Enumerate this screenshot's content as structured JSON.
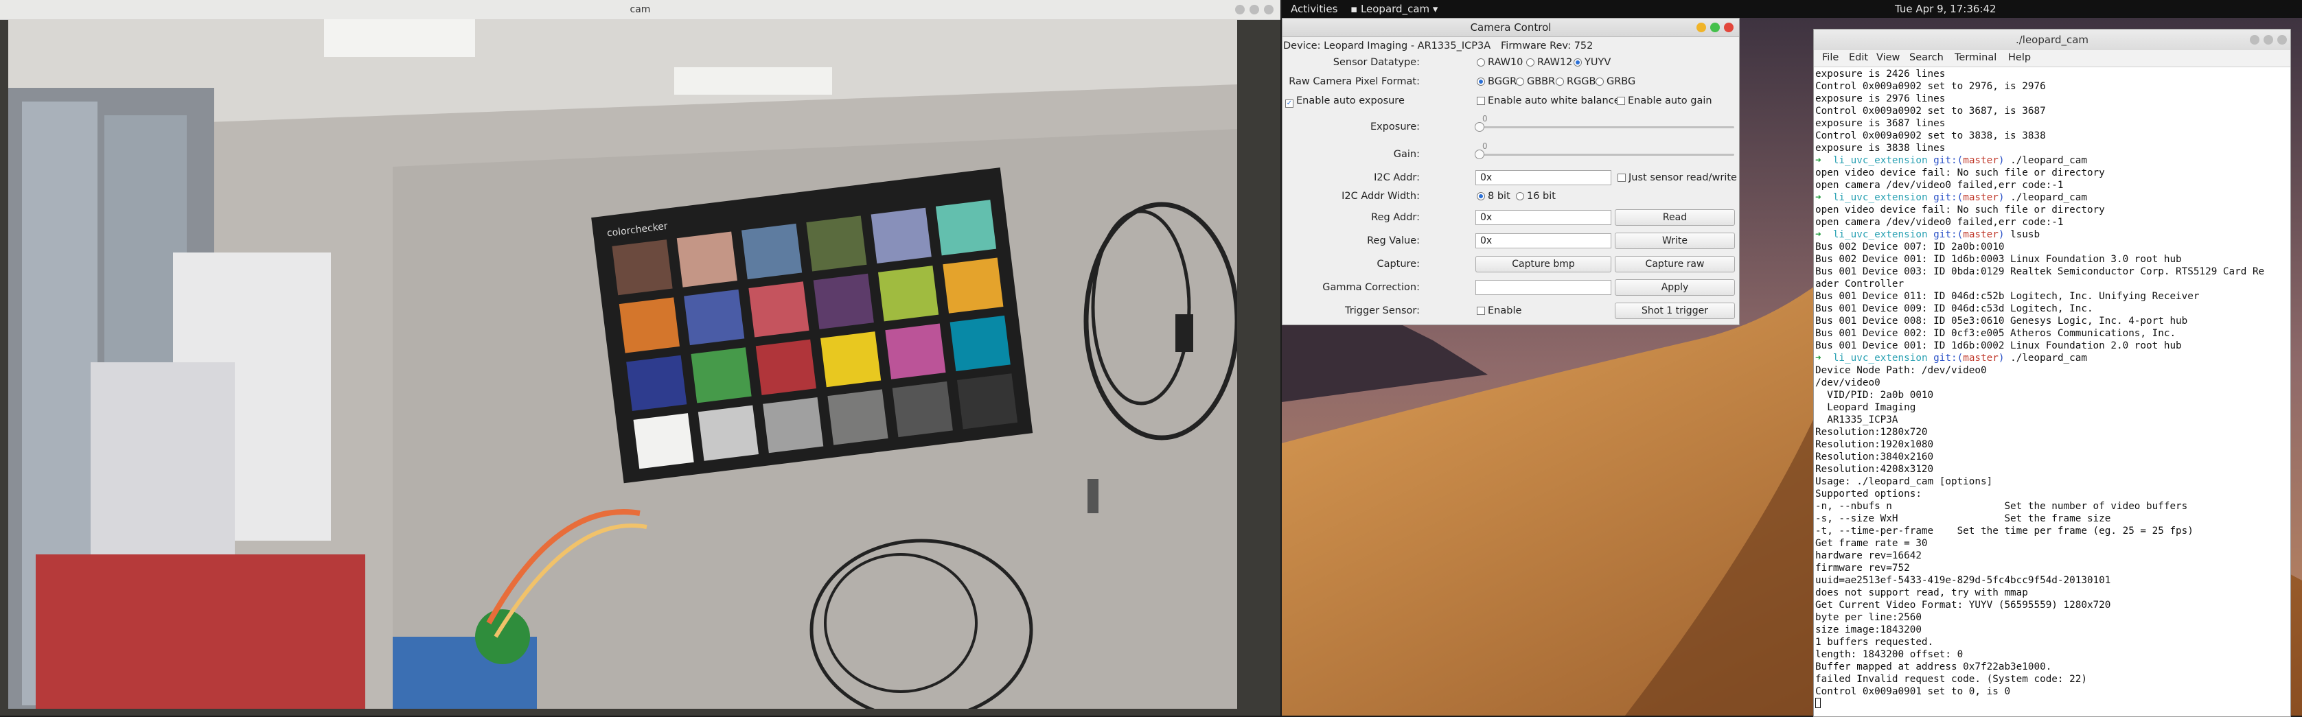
{
  "topbar": {
    "activities": "Activities",
    "app_menu": "Leopard_cam",
    "clock": "Tue Apr  9, 17:36:42"
  },
  "cam_window": {
    "title": "cam",
    "chart_brand": "colorchecker"
  },
  "camera_control": {
    "title": "Camera Control",
    "device": "Device: Leopard Imaging - AR1335_ICP3A",
    "firmware": "Firmware Rev: 752",
    "sensor_datatype_label": "Sensor Datatype:",
    "datatype_options": [
      "RAW10",
      "RAW12",
      "YUYV"
    ],
    "datatype_selected": "YUYV",
    "pixel_format_label": "Raw Camera Pixel Format:",
    "pixel_format_options": [
      "BGGR",
      "GBBR",
      "RGGB",
      "GRBG"
    ],
    "pixel_format_selected": "BGGR",
    "auto_exposure_label": "Enable auto exposure",
    "auto_exposure_checked": true,
    "auto_wb_label": "Enable auto white balance",
    "auto_gain_label": "Enable auto gain",
    "exposure_label": "Exposure:",
    "exposure_value": "0",
    "gain_label": "Gain:",
    "gain_value": "0",
    "i2c_addr_label": "I2C Addr:",
    "i2c_addr_value": "0x",
    "just_sensor_label": "Just sensor read/write",
    "i2c_width_label": "I2C Addr Width:",
    "i2c_width_options": [
      "8 bit",
      "16 bit"
    ],
    "i2c_width_selected": "8 bit",
    "reg_addr_label": "Reg Addr:",
    "reg_addr_value": "0x",
    "read_button": "Read",
    "reg_value_label": "Reg Value:",
    "reg_value_value": "0x",
    "write_button": "Write",
    "capture_label": "Capture:",
    "capture_bmp_button": "Capture bmp",
    "capture_raw_button": "Capture raw",
    "gamma_label": "Gamma Correction:",
    "gamma_value": "",
    "apply_button": "Apply",
    "trigger_label": "Trigger Sensor:",
    "trigger_enable_label": "Enable",
    "shot_button": "Shot 1 trigger"
  },
  "terminal": {
    "title": "./leopard_cam",
    "menu": [
      "File",
      "Edit",
      "View",
      "Search",
      "Terminal",
      "Help"
    ],
    "prompt_dir": "li_uvc_extension",
    "prompt_git": "git:(",
    "prompt_branch": "master",
    "prompt_close": ")",
    "lines": [
      {
        "t": "exposure is 2426 lines"
      },
      {
        "t": "Control 0x009a0902 set to 2976, is 2976"
      },
      {
        "t": "exposure is 2976 lines"
      },
      {
        "t": "Control 0x009a0902 set to 3687, is 3687"
      },
      {
        "t": "exposure is 3687 lines"
      },
      {
        "t": "Control 0x009a0902 set to 3838, is 3838"
      },
      {
        "t": "exposure is 3838 lines"
      },
      {
        "prompt": true,
        "cmd": " ./leopard_cam"
      },
      {
        "t": "open video device fail: No such file or directory"
      },
      {
        "t": "open camera /dev/video0 failed,err code:-1"
      },
      {
        "prompt": true,
        "cmd": " ./leopard_cam"
      },
      {
        "t": "open video device fail: No such file or directory"
      },
      {
        "t": "open camera /dev/video0 failed,err code:-1"
      },
      {
        "prompt": true,
        "cmd": " lsusb"
      },
      {
        "t": "Bus 002 Device 007: ID 2a0b:0010"
      },
      {
        "t": "Bus 002 Device 001: ID 1d6b:0003 Linux Foundation 3.0 root hub"
      },
      {
        "t": "Bus 001 Device 003: ID 0bda:0129 Realtek Semiconductor Corp. RTS5129 Card Re"
      },
      {
        "t": "ader Controller"
      },
      {
        "t": "Bus 001 Device 011: ID 046d:c52b Logitech, Inc. Unifying Receiver"
      },
      {
        "t": "Bus 001 Device 009: ID 046d:c53d Logitech, Inc."
      },
      {
        "t": "Bus 001 Device 008: ID 05e3:0610 Genesys Logic, Inc. 4-port hub"
      },
      {
        "t": "Bus 001 Device 002: ID 0cf3:e005 Atheros Communications, Inc."
      },
      {
        "t": "Bus 001 Device 001: ID 1d6b:0002 Linux Foundation 2.0 root hub"
      },
      {
        "prompt": true,
        "cmd": " ./leopard_cam"
      },
      {
        "t": "Device Node Path: /dev/video0"
      },
      {
        "t": "/dev/video0"
      },
      {
        "t": "  VID/PID: 2a0b 0010"
      },
      {
        "t": "  Leopard Imaging"
      },
      {
        "t": "  AR1335_ICP3A"
      },
      {
        "t": "Resolution:1280x720"
      },
      {
        "t": "Resolution:1920x1080"
      },
      {
        "t": "Resolution:3840x2160"
      },
      {
        "t": "Resolution:4208x3120"
      },
      {
        "t": "Usage: ./leopard_cam [options]"
      },
      {
        "t": "Supported options:"
      },
      {
        "t": "-n, --nbufs n                   Set the number of video buffers"
      },
      {
        "t": "-s, --size WxH                  Set the frame size"
      },
      {
        "t": "-t, --time-per-frame    Set the time per frame (eg. 25 = 25 fps)"
      },
      {
        "t": "Get frame rate = 30"
      },
      {
        "t": "hardware rev=16642"
      },
      {
        "t": "firmware rev=752"
      },
      {
        "t": "uuid=ae2513ef-5433-419e-829d-5fc4bcc9f54d-20130101"
      },
      {
        "t": "does not support read, try with mmap"
      },
      {
        "t": "Get Current Video Format: YUYV (56595559) 1280x720"
      },
      {
        "t": "byte per line:2560"
      },
      {
        "t": "size image:1843200"
      },
      {
        "t": "1 buffers requested."
      },
      {
        "t": "length: 1843200 offset: 0"
      },
      {
        "t": "Buffer mapped at address 0x7f22ab3e1000."
      },
      {
        "t": "failed Invalid request code. (System code: 22)"
      },
      {
        "t": "Control 0x009a0901 set to 0, is 0"
      }
    ]
  },
  "colors": {
    "prompt_arrow": "#1f9a3b",
    "prompt_dir": "#2aa1b3",
    "prompt_branch": "#c0392b",
    "radio_on": "#2a6fd6",
    "desktop_sky": "#6b4a5a"
  }
}
